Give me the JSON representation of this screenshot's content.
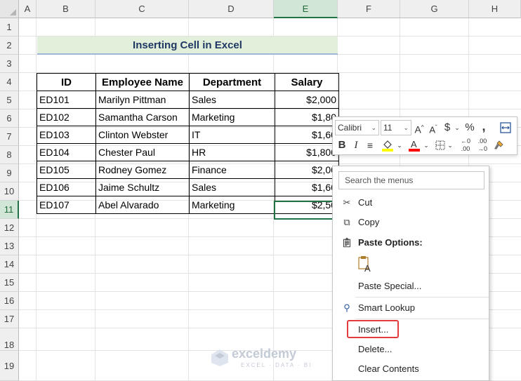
{
  "columns": [
    "A",
    "B",
    "C",
    "D",
    "E",
    "F",
    "G",
    "H"
  ],
  "rows": [
    "1",
    "2",
    "3",
    "4",
    "5",
    "6",
    "7",
    "8",
    "9",
    "10",
    "11",
    "12",
    "13",
    "14",
    "15",
    "16",
    "17",
    "18",
    "19"
  ],
  "selected_column": "E",
  "selected_row": "11",
  "title": "Inserting Cell in Excel",
  "table": {
    "headers": [
      "ID",
      "Employee Name",
      "Department",
      "Salary"
    ],
    "rows": [
      [
        "ED101",
        "Marilyn Pittman",
        "Sales",
        "$2,000"
      ],
      [
        "ED102",
        "Samantha Carson",
        "Marketing",
        "$1,80"
      ],
      [
        "ED103",
        "Clinton Webster",
        "IT",
        "$1,60"
      ],
      [
        "ED104",
        "Chester Paul",
        "HR",
        "$1,800"
      ],
      [
        "ED105",
        "Rodney Gomez",
        "Finance",
        "$2,00"
      ],
      [
        "ED106",
        "Jaime Schultz",
        "Sales",
        "$1,60"
      ],
      [
        "ED107",
        "Abel Alvarado",
        "Marketing",
        "$2,50"
      ]
    ]
  },
  "mini_toolbar": {
    "font": "Calibri",
    "size": "11",
    "increase_font": "A^",
    "decrease_font": "Aˇ",
    "currency": "$",
    "percent": "%",
    "comma": "❟",
    "bold": "B",
    "italic": "I",
    "fill_color": "#ffff00",
    "font_color": "#ff0000"
  },
  "context_menu": {
    "search_placeholder": "Search the menus",
    "cut": "Cut",
    "copy": "Copy",
    "paste_options": "Paste Options:",
    "paste_special": "Paste Special...",
    "smart_lookup": "Smart Lookup",
    "insert": "Insert...",
    "delete": "Delete...",
    "clear_contents": "Clear Contents"
  },
  "watermark": {
    "name": "exceldemy",
    "tagline": "EXCEL · DATA · BI"
  }
}
